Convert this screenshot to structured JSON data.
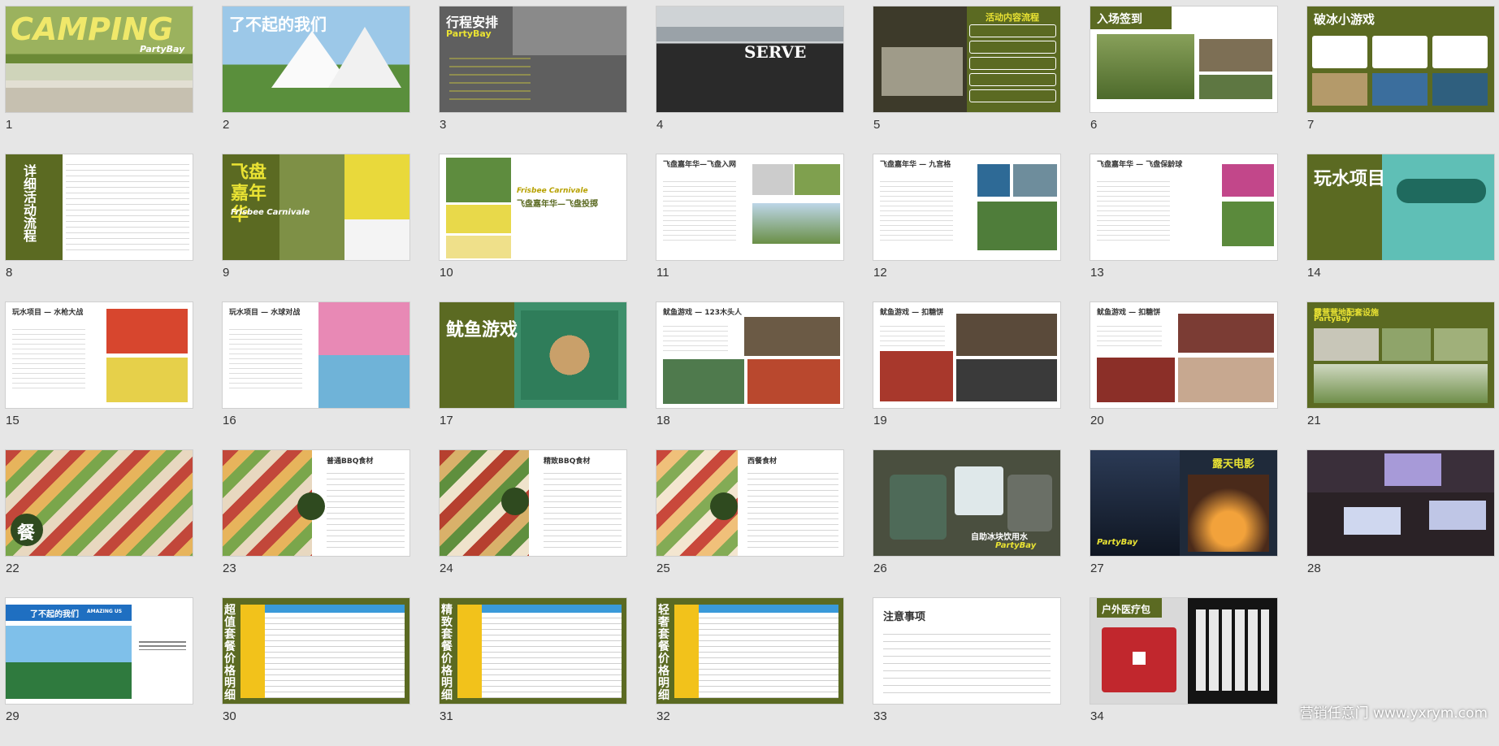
{
  "slides": [
    {
      "number": "1",
      "title": "CAMPING",
      "subtitle": "PartyBay"
    },
    {
      "number": "2",
      "title": "了不起的我们"
    },
    {
      "number": "3",
      "title": "行程安排",
      "subtitle": "PartyBay"
    },
    {
      "number": "4",
      "title": "SERVE"
    },
    {
      "number": "5",
      "title": "活动内容流程"
    },
    {
      "number": "6",
      "title": "入场签到"
    },
    {
      "number": "7",
      "title": "破冰小游戏"
    },
    {
      "number": "8",
      "title": "详细活动流程"
    },
    {
      "number": "9",
      "title": "飞盘嘉年华",
      "subtitle": "Frisbee Carnivale"
    },
    {
      "number": "10",
      "title": "飞盘嘉年华—飞盘投掷",
      "subtitle": "Frisbee Carnivale"
    },
    {
      "number": "11",
      "title": "飞盘嘉年华—飞盘入网"
    },
    {
      "number": "12",
      "title": "飞盘嘉年华 — 九宫格"
    },
    {
      "number": "13",
      "title": "飞盘嘉年华 — 飞盘保龄球"
    },
    {
      "number": "14",
      "title": "玩水项目"
    },
    {
      "number": "15",
      "title": "玩水项目 — 水枪大战"
    },
    {
      "number": "16",
      "title": "玩水项目 — 水球对战"
    },
    {
      "number": "17",
      "title": "鱿鱼游戏"
    },
    {
      "number": "18",
      "title": "鱿鱼游戏 — 123木头人"
    },
    {
      "number": "19",
      "title": "鱿鱼游戏 — 扣糖饼"
    },
    {
      "number": "20",
      "title": "鱿鱼游戏 — 扣糖饼"
    },
    {
      "number": "21",
      "title": "露营营地配套设施",
      "subtitle": "PartyBay"
    },
    {
      "number": "22",
      "title": "餐"
    },
    {
      "number": "23",
      "title": "普通BBQ食材"
    },
    {
      "number": "24",
      "title": "精致BBQ食材"
    },
    {
      "number": "25",
      "title": "西餐食材"
    },
    {
      "number": "26",
      "title": "自助冰块饮用水",
      "subtitle": "PartyBay"
    },
    {
      "number": "27",
      "title": "露天电影",
      "subtitle": "PartyBay"
    },
    {
      "number": "28",
      "title": ""
    },
    {
      "number": "29",
      "title": "了不起的我们",
      "subtitle": "AMAZING US"
    },
    {
      "number": "30",
      "title": "超值套餐价格明细"
    },
    {
      "number": "31",
      "title": "精致套餐价格明细"
    },
    {
      "number": "32",
      "title": "轻奢套餐价格明细"
    },
    {
      "number": "33",
      "title": "注意事项"
    },
    {
      "number": "34",
      "title": "户外医疗包"
    }
  ],
  "watermark": "营销任意门 www.yxrym.com",
  "colors": {
    "accent_green": "#5b6a22",
    "accent_yellow": "#e9e233",
    "background": "#e6e6e6"
  }
}
